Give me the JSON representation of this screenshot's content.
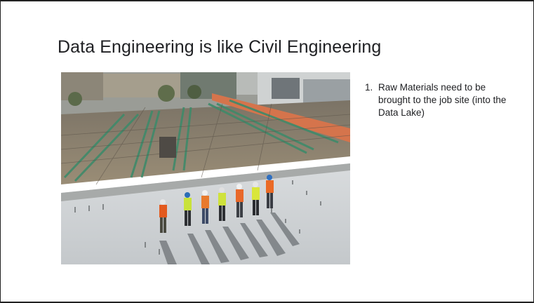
{
  "slide": {
    "title": "Data Engineering is like Civil Engineering",
    "bullets": [
      {
        "number": "1.",
        "text": "Raw Materials need to be brought to the job site (into the Data Lake)"
      }
    ]
  },
  "photo": {
    "icon": "construction-site-photo",
    "description_colors": {
      "slab": "#c9cdd0",
      "rebar_green": "#3f8a6a",
      "dirt": "#8a7a64",
      "buildings": "#8f969a",
      "sky_shadow": "#6d7276"
    }
  }
}
